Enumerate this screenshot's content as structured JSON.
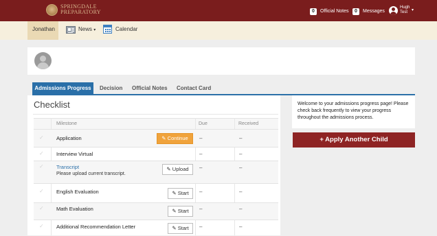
{
  "header": {
    "logo_line1": "SPRINGDALE",
    "logo_line2": "PREPARATORY",
    "official_notes_count": "0",
    "official_notes_label": "Official Notes",
    "messages_count": "0",
    "messages_label": "Messages",
    "user_first": "Hugh",
    "user_last": "Test",
    "caret": "▾"
  },
  "nav": {
    "user": "Jonathan",
    "news": "News",
    "news_caret": "▾",
    "calendar": "Calendar"
  },
  "tabs": [
    "Admissions Progress",
    "Decision",
    "Official Notes",
    "Contact Card"
  ],
  "checklist": {
    "title": "Checklist",
    "columns": {
      "milestone": "Milestone",
      "due": "Due",
      "received": "Received"
    },
    "check_glyph": "✓",
    "rows": [
      {
        "milestone": "Application",
        "action": "✎ Continue",
        "due": "–",
        "received": "–"
      },
      {
        "milestone": "Interview Virtual",
        "action": "",
        "due": "–",
        "received": "–"
      },
      {
        "milestone": "Transcript",
        "subtext": "Please upload current transcript.",
        "action": "✎ Upload",
        "due": "–",
        "received": "–"
      },
      {
        "milestone": "English Evaluation",
        "action": "✎ Start",
        "due": "–",
        "received": "–"
      },
      {
        "milestone": "Math Evaluation",
        "action": "✎ Start",
        "due": "–",
        "received": "–"
      },
      {
        "milestone": "Additional Recommendation Letter",
        "action": "✎ Start",
        "due": "–",
        "received": "–"
      }
    ]
  },
  "sidebar": {
    "welcome": "Welcome to your admissions progress page! Please check back frequently to view your progress throughout the admissions process.",
    "apply_button": "+ Apply Another Child"
  },
  "colors": {
    "brand": "#7a1d1d",
    "accent_blue": "#2a6fa8",
    "continue_orange": "#f0a33c",
    "apply_red": "#8e2424"
  },
  "icons": [
    "school-seal-icon",
    "user-circle-icon",
    "news-icon",
    "calendar-icon",
    "check-icon",
    "edit-icon",
    "avatar-placeholder-icon"
  ]
}
